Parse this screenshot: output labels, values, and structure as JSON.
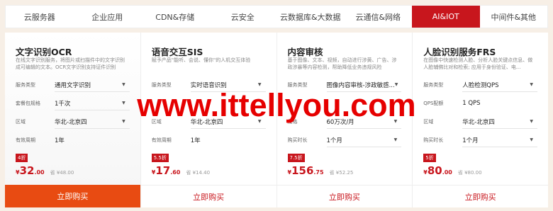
{
  "tabs": [
    "云服务器",
    "企业应用",
    "CDN&存储",
    "云安全",
    "云数据库&大数据",
    "云通信&网络",
    "AI&IOT",
    "中间件&其他"
  ],
  "active_tab_index": 6,
  "cards": [
    {
      "title": "文字识别OCR",
      "desc": "在线文字识别服务，将图片或扫描件中的文字识别成可编辑的文本。OCR文字识别支持证件识别",
      "rows": [
        {
          "label": "服务类型",
          "value": "通用文字识别",
          "dropdown": true
        },
        {
          "label": "套餐包规格",
          "value": "1千次",
          "dropdown": true
        },
        {
          "label": "区域",
          "value": "华北-北京四",
          "dropdown": true
        },
        {
          "label": "有效周期",
          "value": "1年",
          "dropdown": false
        }
      ],
      "discount": "4折",
      "currency": "¥",
      "price_int": "32",
      "price_dec": ".00",
      "orig_price": "省 ¥48.00",
      "buy_label": "立即购买"
    },
    {
      "title": "语音交互SIS",
      "desc": "赋予产品\"能听、会说、懂你\"的人机交互体验",
      "rows": [
        {
          "label": "服务类型",
          "value": "实时语音识别",
          "dropdown": true
        },
        {
          "label": "",
          "value": "",
          "dropdown": false
        },
        {
          "label": "区域",
          "value": "华北-北京四",
          "dropdown": true
        },
        {
          "label": "有效周期",
          "value": "1年",
          "dropdown": false
        }
      ],
      "discount": "5.5折",
      "currency": "¥",
      "price_int": "17",
      "price_dec": ".60",
      "orig_price": "省 ¥14.40",
      "buy_label": "立即购买"
    },
    {
      "title": "内容审核",
      "desc": "基于图像、文本、视频，自动进行涉黄、广告、涉政涉暴等内容检测，帮助降低业务违规风险",
      "rows": [
        {
          "label": "服务类型",
          "value": "图像内容审核-涉政敏感...",
          "dropdown": true
        },
        {
          "label": "",
          "value": "",
          "dropdown": false
        },
        {
          "label": "规格",
          "value": "60万次/月",
          "dropdown": true
        },
        {
          "label": "购买时长",
          "value": "1个月",
          "dropdown": true
        }
      ],
      "discount": "7.5折",
      "currency": "¥",
      "price_int": "156",
      "price_dec": ".75",
      "orig_price": "省 ¥52.25",
      "buy_label": "立即购买"
    },
    {
      "title": "人脸识别服务FRS",
      "desc": "在图像中快速检测人脸、分析人脸关键点信息、做人脸辅佛比对和检索; 应用于身份验证、电...",
      "rows": [
        {
          "label": "服务类型",
          "value": "人脸检测QPS",
          "dropdown": true
        },
        {
          "label": "QPS配额",
          "value": "1 QPS",
          "dropdown": false
        },
        {
          "label": "区域",
          "value": "华北-北京四",
          "dropdown": true
        },
        {
          "label": "购买时长",
          "value": "1个月",
          "dropdown": true
        }
      ],
      "discount": "5折",
      "currency": "¥",
      "price_int": "80",
      "price_dec": ".00",
      "orig_price": "省 ¥80.00",
      "buy_label": "立即购买"
    }
  ],
  "watermark": "www.ittellyou.com",
  "icons": {
    "dropdown": "caret-down-icon"
  },
  "colors": {
    "accent": "#c8161d",
    "buy_primary": "#e84b12",
    "watermark": "#e60000"
  }
}
